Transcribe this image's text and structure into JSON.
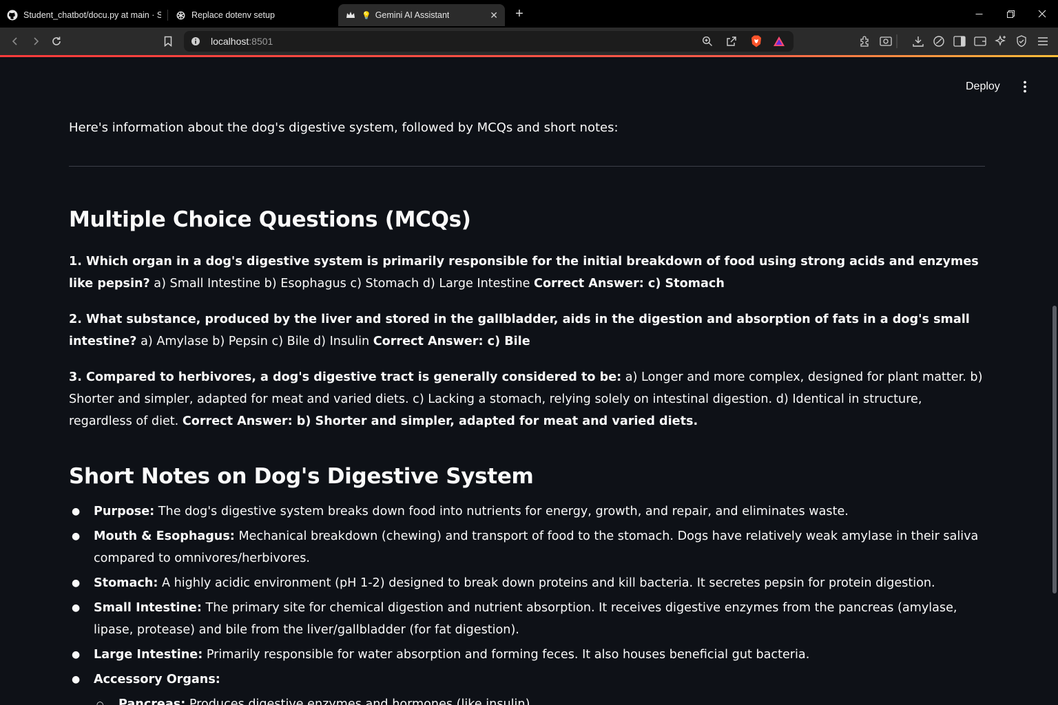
{
  "browser": {
    "tabs": [
      {
        "title": "Student_chatbot/docu.py at main · Sa",
        "icon": "github-icon"
      },
      {
        "title": "Replace dotenv setup",
        "icon": "openai-icon"
      },
      {
        "title": "Gemini AI Assistant",
        "emoji": "💡",
        "icon": "streamlit-crown-icon",
        "active": true
      }
    ],
    "new_tab_label": "+",
    "address": {
      "host": "localhost",
      "port": ":8501"
    },
    "accent_colors": {
      "load_bar_start": "#ff3b3b",
      "load_bar_end": "#ffbf3a",
      "brave": "#fb542b"
    }
  },
  "app": {
    "deploy_label": "Deploy",
    "intro": "Here's information about the dog's digestive system, followed by MCQs and short notes:",
    "mcq_heading": "Multiple Choice Questions (MCQs)",
    "questions": [
      {
        "question": "1. Which organ in a dog's digestive system is primarily responsible for the initial breakdown of food using strong acids and enzymes like pepsin?",
        "options": " a) Small Intestine b) Esophagus c) Stomach d) Large Intestine ",
        "answer": "Correct Answer: c) Stomach"
      },
      {
        "question": "2. What substance, produced by the liver and stored in the gallbladder, aids in the digestion and absorption of fats in a dog's small intestine?",
        "options": " a) Amylase b) Pepsin c) Bile d) Insulin ",
        "answer": "Correct Answer: c) Bile"
      },
      {
        "question": "3. Compared to herbivores, a dog's digestive tract is generally considered to be:",
        "options": " a) Longer and more complex, designed for plant matter. b) Shorter and simpler, adapted for meat and varied diets. c) Lacking a stomach, relying solely on intestinal digestion. d) Identical in structure, regardless of diet. ",
        "answer": "Correct Answer: b) Shorter and simpler, adapted for meat and varied diets."
      }
    ],
    "notes_heading": "Short Notes on Dog's Digestive System",
    "notes": [
      {
        "term": "Purpose:",
        "text": " The dog's digestive system breaks down food into nutrients for energy, growth, and repair, and eliminates waste."
      },
      {
        "term": "Mouth & Esophagus:",
        "text": " Mechanical breakdown (chewing) and transport of food to the stomach. Dogs have relatively weak amylase in their saliva compared to omnivores/herbivores."
      },
      {
        "term": "Stomach:",
        "text": " A highly acidic environment (pH 1-2) designed to break down proteins and kill bacteria. It secretes pepsin for protein digestion."
      },
      {
        "term": "Small Intestine:",
        "text": " The primary site for chemical digestion and nutrient absorption. It receives digestive enzymes from the pancreas (amylase, lipase, protease) and bile from the liver/gallbladder (for fat digestion)."
      },
      {
        "term": "Large Intestine:",
        "text": " Primarily responsible for water absorption and forming feces. It also houses beneficial gut bacteria."
      },
      {
        "term": "Accessory Organs:",
        "text": ""
      }
    ],
    "sub_notes": [
      {
        "term": "Pancreas:",
        "text": " Produces digestive enzymes and hormones (like insulin)."
      }
    ]
  }
}
